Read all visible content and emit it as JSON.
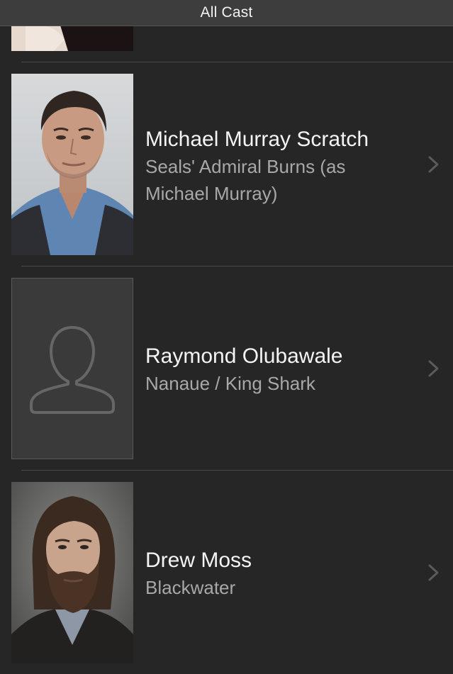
{
  "header": {
    "title": "All Cast"
  },
  "cast": [
    {
      "name": "Michael Murray Scratch",
      "role": "Seals' Admiral Burns (as Michael Murray)",
      "photo": "headshot"
    },
    {
      "name": "Raymond Olubawale",
      "role": "Nanaue / King Shark",
      "photo": "placeholder-person-icon"
    },
    {
      "name": "Drew Moss",
      "role": "Blackwater",
      "photo": "headshot"
    }
  ],
  "colors": {
    "background": "#262626",
    "navbar": "#3d3d3d",
    "name_text": "#f4f4f4",
    "role_text": "#a8a8a8",
    "divider": "#4a4a4a",
    "placeholder_bg": "#3a3a3a"
  }
}
